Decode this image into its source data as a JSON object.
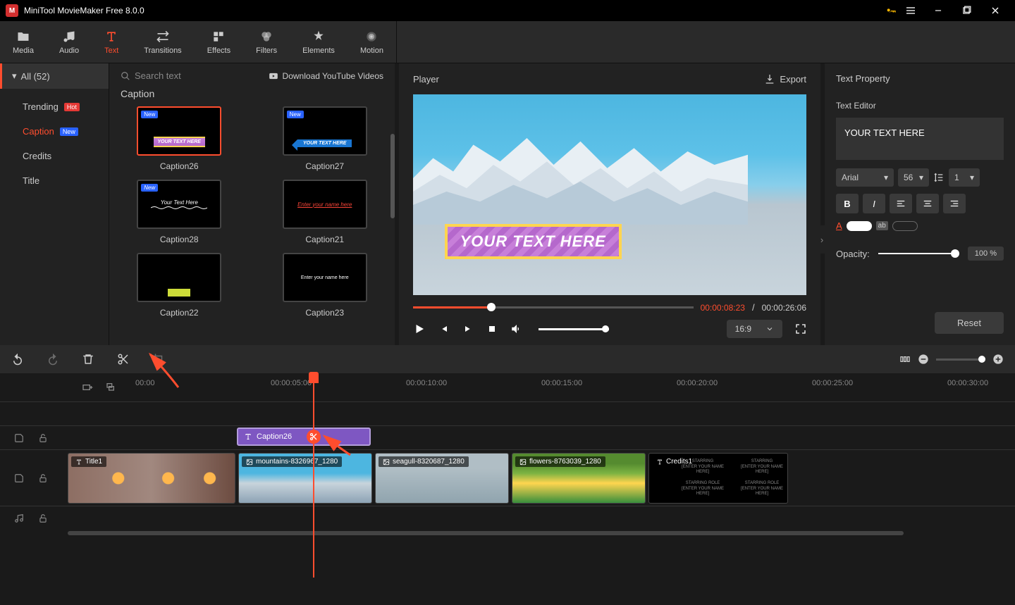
{
  "app": {
    "title": "MiniTool MovieMaker Free 8.0.0"
  },
  "toolbar": {
    "media": "Media",
    "audio": "Audio",
    "text": "Text",
    "transitions": "Transitions",
    "effects": "Effects",
    "filters": "Filters",
    "elements": "Elements",
    "motion": "Motion"
  },
  "sidebar": {
    "all_label": "All (52)",
    "items": [
      {
        "label": "Trending",
        "badge": "Hot"
      },
      {
        "label": "Caption",
        "badge": "New"
      },
      {
        "label": "Credits"
      },
      {
        "label": "Title"
      }
    ]
  },
  "gallery": {
    "search_placeholder": "Search text",
    "download_label": "Download YouTube Videos",
    "section_title": "Caption",
    "templates": [
      {
        "name": "Caption26",
        "new": true
      },
      {
        "name": "Caption27",
        "new": true
      },
      {
        "name": "Caption28",
        "new": true
      },
      {
        "name": "Caption21"
      },
      {
        "name": "Caption22"
      },
      {
        "name": "Caption23"
      }
    ],
    "thumb_text": {
      "cap26": "YOUR TEXT HERE",
      "cap27": "YOUR TEXT HERE",
      "cap28": "Your Text Here",
      "cap21": "Enter your name here",
      "cap23": "Enter your name here"
    }
  },
  "player": {
    "header": "Player",
    "export": "Export",
    "caption_text": "YOUR TEXT HERE",
    "time_current": "00:00:08:23",
    "time_total": "00:00:26:06",
    "aspect": "16:9"
  },
  "props": {
    "header": "Text Property",
    "editor_label": "Text Editor",
    "text_value": "YOUR TEXT HERE",
    "font": "Arial",
    "size": "56",
    "spacing": "1",
    "opacity_label": "Opacity:",
    "opacity_value": "100 %",
    "reset": "Reset"
  },
  "timeline": {
    "marks": [
      "00:00",
      "00:00:05:00",
      "00:00:10:00",
      "00:00:15:00",
      "00:00:20:00",
      "00:00:25:00",
      "00:00:30:00"
    ],
    "text_clip": "Caption26",
    "clips": [
      {
        "label": "Title1",
        "type": "title"
      },
      {
        "label": "mountains-8326967_1280",
        "type": "image"
      },
      {
        "label": "seagull-8320687_1280",
        "type": "image"
      },
      {
        "label": "flowers-8763039_1280",
        "type": "image"
      },
      {
        "label": "Credits1",
        "type": "title"
      }
    ],
    "credits_preview": "STARRING\n[ENTER YOUR NAME HERE]\n\nSTARRING ROLE\n[ENTER YOUR NAME HERE]"
  }
}
